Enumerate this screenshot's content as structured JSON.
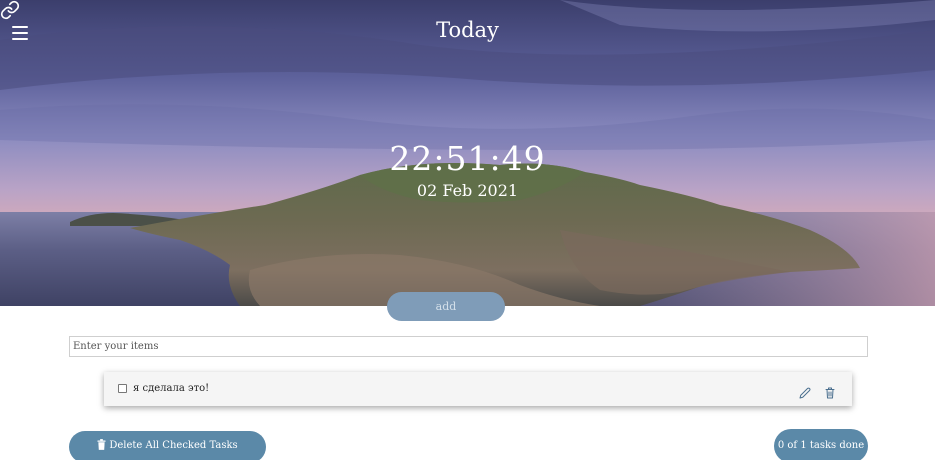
{
  "header": {
    "title": "Today",
    "menu_icon": "hamburger-menu-icon",
    "link_icon": "link-chain-icon"
  },
  "clock": {
    "time": "22:51:49",
    "date": "02 Feb 2021"
  },
  "add_button": {
    "label": "add"
  },
  "input": {
    "placeholder": "Enter your items",
    "value": ""
  },
  "tasks": [
    {
      "text": "я сделала это!",
      "checked": false,
      "edit_icon": "pencil-icon",
      "delete_icon": "trash-icon"
    }
  ],
  "footer": {
    "delete_all_label": "Delete All Checked Tasks",
    "delete_all_icon": "trash-icon",
    "done_count": "0 of 1 tasks done"
  },
  "colors": {
    "accent": "#5b89a8",
    "add_button": "#7f9cb8",
    "card_bg": "#f5f5f5"
  }
}
